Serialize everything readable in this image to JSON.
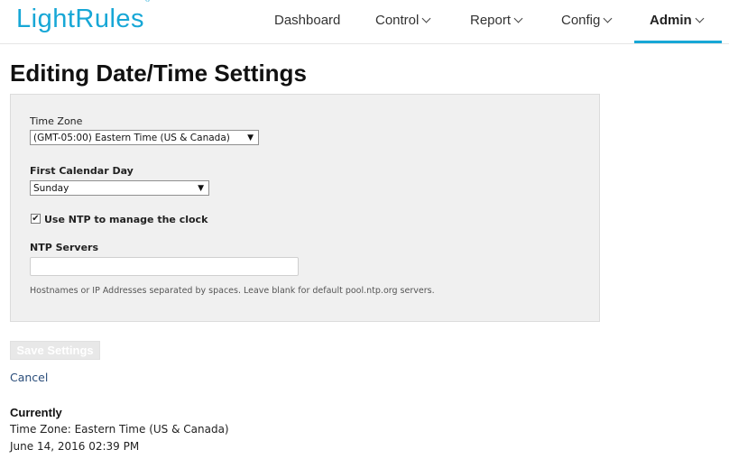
{
  "logo": {
    "text": "LightRules",
    "mark": "®"
  },
  "nav": {
    "dashboard": "Dashboard",
    "control": "Control",
    "report": "Report",
    "config": "Config",
    "admin": "Admin"
  },
  "page": {
    "title": "Editing Date/Time Settings"
  },
  "form": {
    "timezone_label": "Time Zone",
    "timezone_value": "(GMT-05:00) Eastern Time (US & Canada)",
    "first_day_label": "First Calendar Day",
    "first_day_value": "Sunday",
    "ntp_checkbox_label": "Use NTP to manage the clock",
    "ntp_checked": true,
    "ntp_servers_label": "NTP Servers",
    "ntp_servers_value": "",
    "ntp_hint": "Hostnames or IP Addresses separated by spaces. Leave blank for default pool.ntp.org servers."
  },
  "actions": {
    "save_label": "Save Settings",
    "cancel_label": "Cancel"
  },
  "current": {
    "heading": "Currently",
    "timezone_line": "Time Zone: Eastern Time (US & Canada)",
    "datetime_line": "June 14, 2016 02:39 PM"
  },
  "colors": {
    "brand": "#17a7d6",
    "panel_bg": "#f0f0f0",
    "link": "#2a4d7a"
  }
}
